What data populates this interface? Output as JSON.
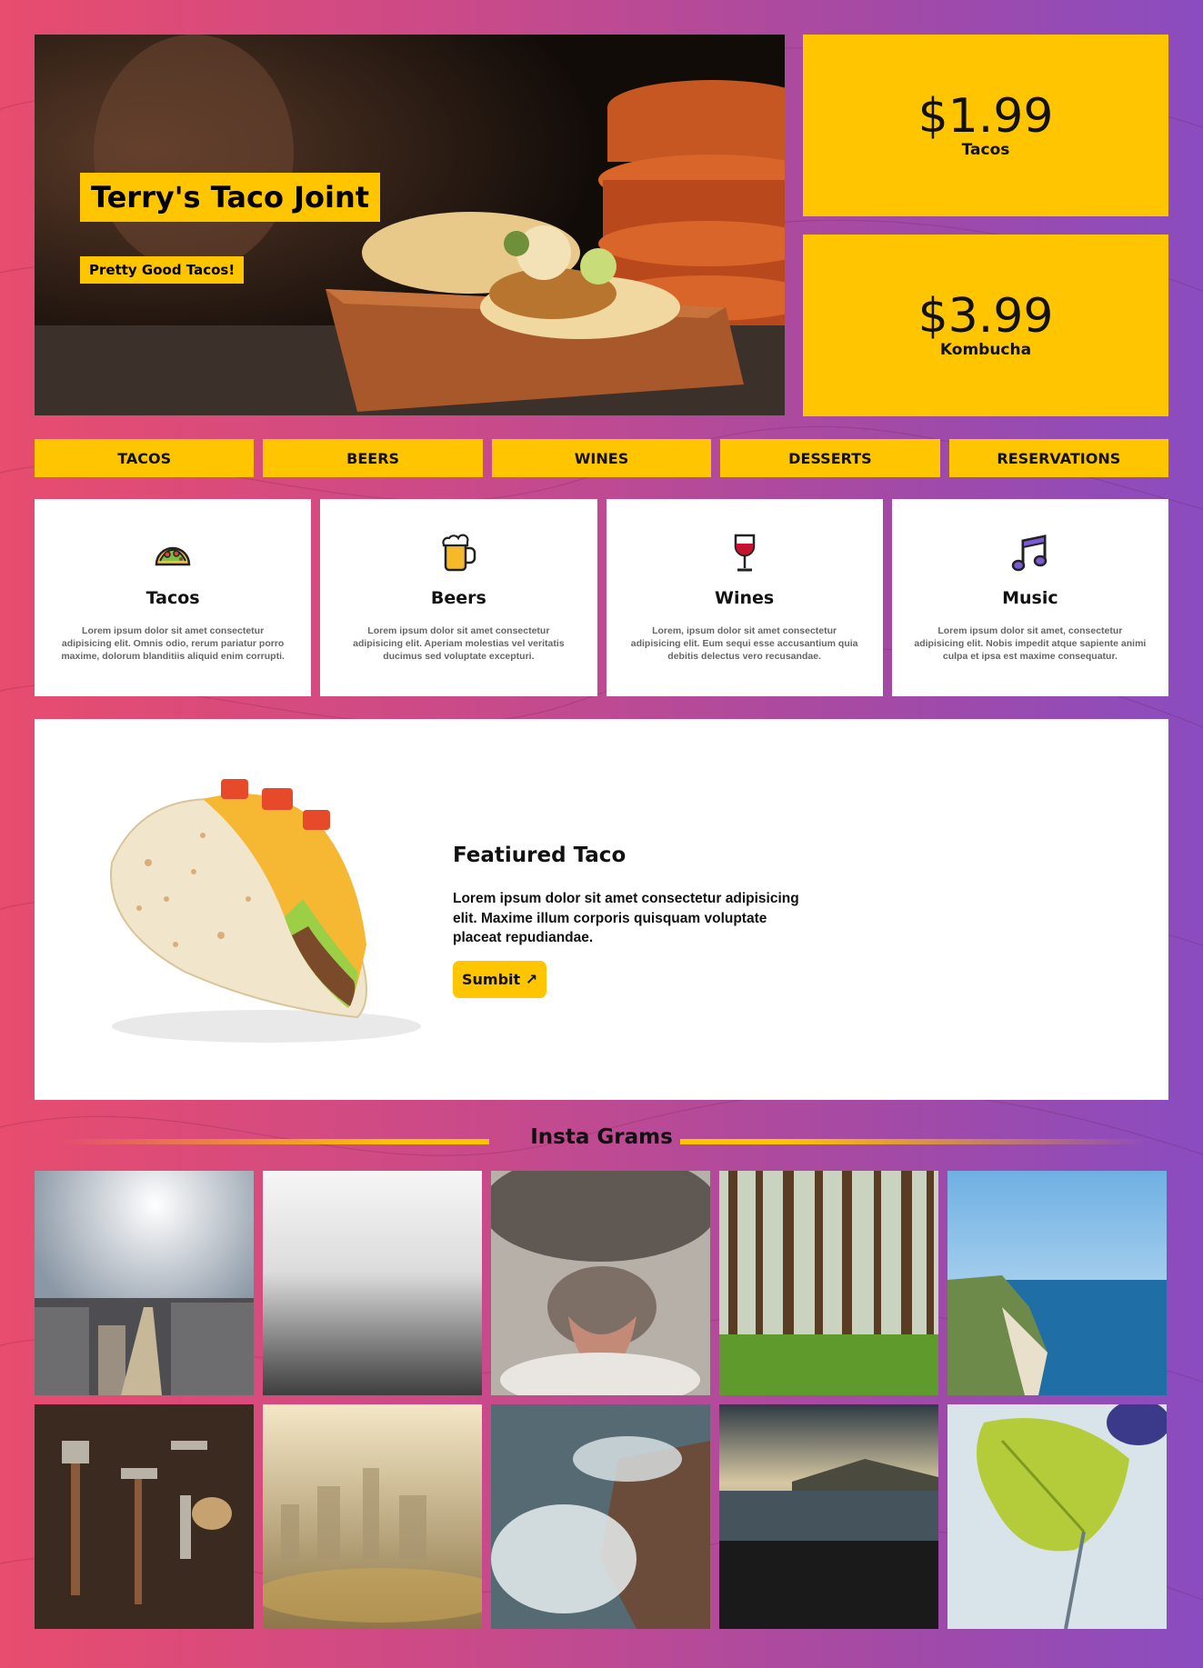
{
  "hero": {
    "title": "Terry's Taco Joint",
    "subtitle": "Pretty Good Tacos!"
  },
  "prices": [
    {
      "amount": "$1.99",
      "label": "Tacos"
    },
    {
      "amount": "$3.99",
      "label": "Kombucha"
    }
  ],
  "nav": [
    "TACOS",
    "BEERS",
    "WINES",
    "DESSERTS",
    "RESERVATIONS"
  ],
  "features": [
    {
      "icon": "taco-icon",
      "title": "Tacos",
      "text": "Lorem ipsum dolor sit amet consectetur adipisicing elit. Omnis odio, rerum pariatur porro maxime, dolorum blanditiis aliquid enim corrupti."
    },
    {
      "icon": "beer-icon",
      "title": "Beers",
      "text": "Lorem ipsum dolor sit amet consectetur adipisicing elit. Aperiam molestias vel veritatis ducimus sed voluptate excepturi."
    },
    {
      "icon": "wine-icon",
      "title": "Wines",
      "text": "Lorem, ipsum dolor sit amet consectetur adipisicing elit. Eum sequi esse accusantium quia debitis delectus vero recusandae."
    },
    {
      "icon": "music-icon",
      "title": "Music",
      "text": "Lorem ipsum dolor sit amet, consectetur adipisicing elit. Nobis impedit atque sapiente animi culpa et ipsa est maxime consequatur."
    }
  ],
  "featured": {
    "title": "Featiured Taco",
    "text": "Lorem ipsum dolor sit amet consectetur adipisicing elit. Maxime illum corporis quisquam voluptate placeat repudiandae.",
    "button": "Sumbit ↗"
  },
  "insta": {
    "title": "Insta Grams"
  },
  "colors": {
    "accent": "#ffc600",
    "gradient_start": "#e84c6e",
    "gradient_end": "#8a4cc0"
  }
}
